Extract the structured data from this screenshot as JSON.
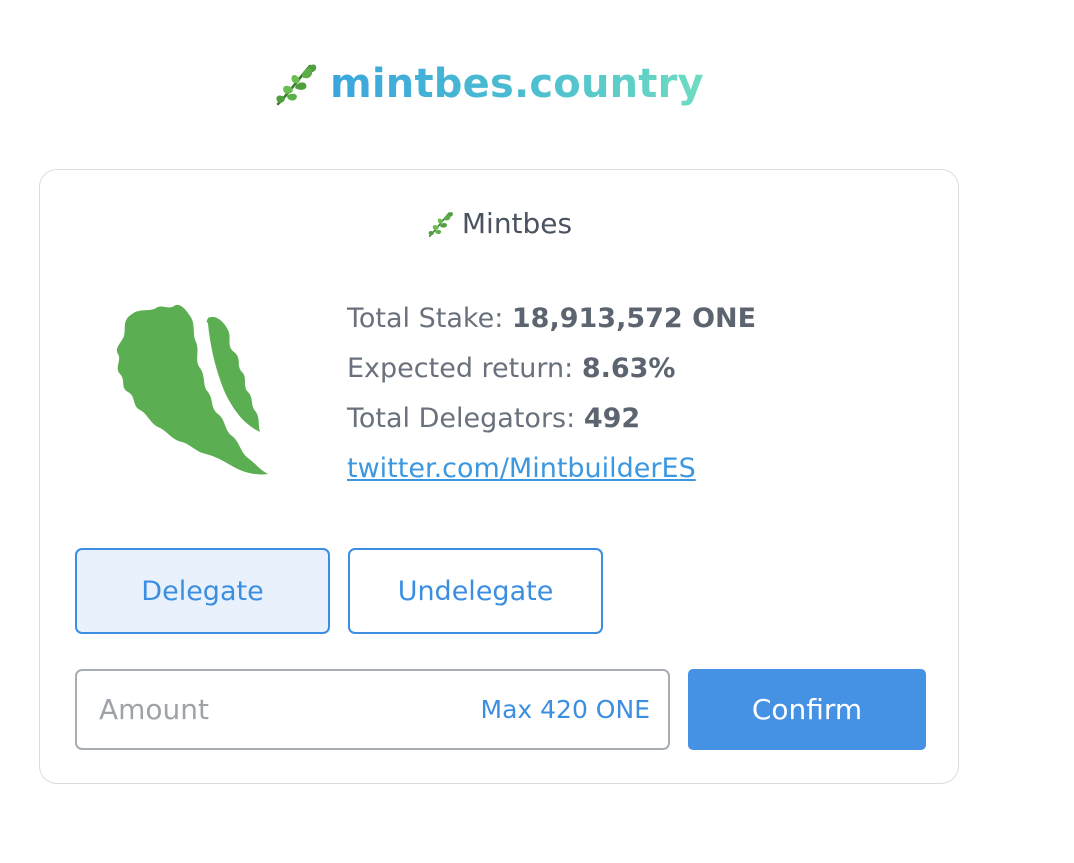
{
  "header": {
    "brand_icon": "herb-sprig-icon",
    "title": "mintbes.country"
  },
  "validator": {
    "icon": "herb-sprig-icon",
    "name": "Mintbes",
    "logo": "green-leaf-logo",
    "stats": {
      "total_stake_label": "Total Stake:",
      "total_stake_value": "18,913,572 ONE",
      "expected_return_label": "Expected return:",
      "expected_return_value": "8.63%",
      "total_delegators_label": "Total Delegators:",
      "total_delegators_value": "492"
    },
    "twitter_link": "twitter.com/MintbuilderES"
  },
  "actions": {
    "delegate_label": "Delegate",
    "undelegate_label": "Undelegate",
    "active_tab": "Delegate"
  },
  "amount_form": {
    "placeholder": "Amount",
    "value": "",
    "max_label": "Max 420 ONE",
    "confirm_label": "Confirm"
  },
  "colors": {
    "accent": "#3b8ee0",
    "confirm_bg": "#4591e3",
    "active_tab_bg": "#e9f2fc",
    "leaf_green": "#5cae53",
    "title_gradient_start": "#3aa6dc",
    "title_gradient_end": "#6fdcc0"
  }
}
